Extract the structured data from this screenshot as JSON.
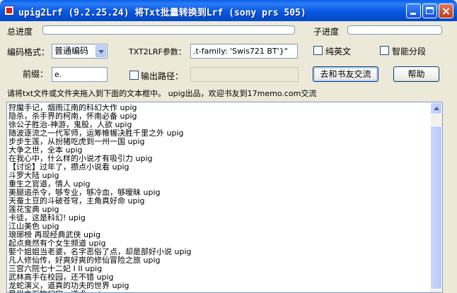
{
  "window": {
    "title": "upig2Lrf (9.2.25.24) 将Txt批量转换到Lrf (sony prs 505)",
    "controls": {
      "minimize": "_",
      "maximize": "□",
      "close": "×"
    }
  },
  "progress": {
    "total_label": "总进度",
    "sub_label": "子进度",
    "total_value": 0,
    "sub_value": 0
  },
  "options": {
    "encoding_label": "编码格式：",
    "encoding_value": "普通编码",
    "params_label": "TXT2LRF参数：",
    "params_value": ".t-family: 'Swis721 BT'}\"",
    "pure_english_label": "纯英文",
    "smart_split_label": "智能分段",
    "prefix_label": "前缀：",
    "prefix_value": "e.",
    "output_path_label": "输出路径：",
    "output_path_value": "",
    "exchange_button": "去和书友交流",
    "help_button": "帮助"
  },
  "hint": "请将txt文件或文件夹拖入到下面的文本框中。  upig出品，欢迎书友到17memo.com交流",
  "lines": [
    "狩魔手记，烟雨江南的科幻大作 upig",
    "隐杀，杀手界的柯南，怀南必备 upig",
    "徐公子胜治-神游，鬼股，人欲 upig",
    "随波逐流之一代军师，运筹帷幄决胜千里之外 upig",
    "步步生莲，从扮猪吃虎到一州一国 upig",
    "大争之世，全本 upig",
    "在我心中，什么样的小说才有吸引力 upig",
    "【讨论】过年了，攒点小说看 upig",
    "斗罗大陆 upig",
    "重生之官道，情人 upig",
    "美腿追杀令，够专业，够冷血，够暧昧 upig",
    "天蚕土豆的斗破苍穹，主角真好命 upig",
    "莲花宝典 upig",
    "卡徒，这是科幻! upig",
    "江山美色 upig",
    "琅琊榜 再现经典武侠 upig",
    "起点竟然有个女生频道 upig",
    "娶个姐姐当老婆，名字恶俗了点，却是部好小说 upig",
    "凡人修仙传，好爽好爽的修仙冒险之旅 upig",
    "三宫六院七十二妃 I II upig",
    "武林高手在校园，还不错 upig",
    "龙蛇演义，道真的功夫的世界 upig",
    "异世之万物归宗，道术 upig"
  ]
}
